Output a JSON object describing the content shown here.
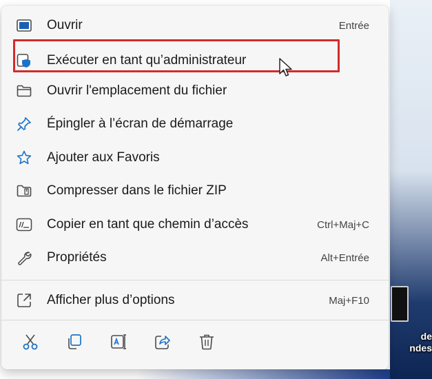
{
  "menu": {
    "items": [
      {
        "label": "Ouvrir",
        "shortcut": "Entrée",
        "icon": "open-window-icon"
      },
      {
        "label": "Exécuter en tant qu’administrateur",
        "shortcut": "",
        "icon": "shield-admin-icon"
      },
      {
        "label": "Ouvrir l'emplacement du fichier",
        "shortcut": "",
        "icon": "folder-icon"
      },
      {
        "label": "Épingler à l’écran de démarrage",
        "shortcut": "",
        "icon": "pin-icon"
      },
      {
        "label": "Ajouter aux Favoris",
        "shortcut": "",
        "icon": "star-icon"
      },
      {
        "label": "Compresser dans le fichier ZIP",
        "shortcut": "",
        "icon": "zip-folder-icon"
      },
      {
        "label": "Copier en tant que chemin d’accès",
        "shortcut": "Ctrl+Maj+C",
        "icon": "copy-path-icon"
      },
      {
        "label": "Propriétés",
        "shortcut": "Alt+Entrée",
        "icon": "wrench-icon"
      },
      {
        "label": "Afficher plus d’options",
        "shortcut": "Maj+F10",
        "icon": "more-options-icon"
      }
    ],
    "toolbar": [
      "cut-icon",
      "copy-icon",
      "rename-icon",
      "share-icon",
      "delete-icon"
    ]
  },
  "desktop": {
    "label": "de\nndes"
  },
  "colors": {
    "accent": "#1a73c8",
    "highlight_border": "#d42a2a",
    "menu_bg": "#f6f6f6"
  }
}
